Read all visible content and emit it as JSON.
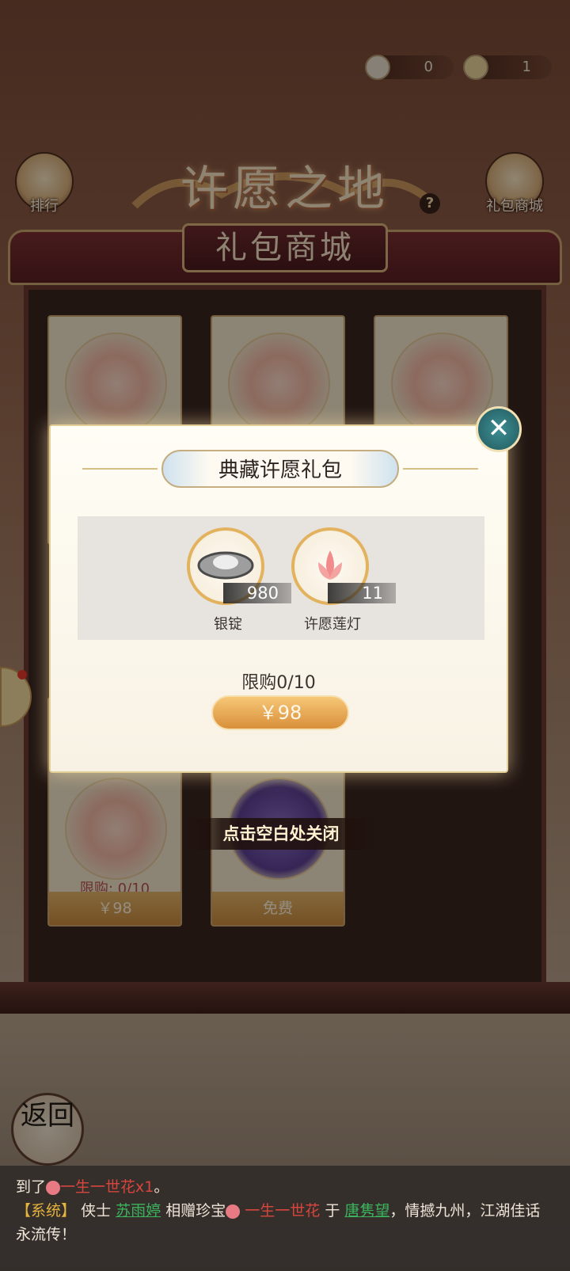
{
  "currency": [
    {
      "icon": "lotus-lantern-icon",
      "value": "0"
    },
    {
      "icon": "ginkgo-leaf-icon",
      "value": "1"
    }
  ],
  "header": {
    "title": "许愿之地",
    "help": "?"
  },
  "side": {
    "ranking_label": "排行",
    "shop_label": "礼包商城"
  },
  "shop": {
    "title": "礼包商城",
    "cards": [
      {
        "limit": "限购: 0/10",
        "price": "￥98"
      },
      {
        "limit": "",
        "price": "免费"
      }
    ]
  },
  "popup": {
    "title": "典藏许愿礼包",
    "items": [
      {
        "name": "银锭",
        "qty": "980",
        "icon": "silver-ingot-icon"
      },
      {
        "name": "许愿莲灯",
        "qty": "11",
        "icon": "lotus-lamp-icon"
      }
    ],
    "limit": "限购0/10",
    "price": "￥98",
    "close": "✕"
  },
  "hint": "点击空白处关闭",
  "back": "返回",
  "log": {
    "line1_prefix": "到了",
    "line1_item": "一生一世花x1",
    "line1_end": "。",
    "sys_tag": "【系统】",
    "part1": "侠士",
    "giver": "苏雨婷",
    "part2": "相赠珍宝",
    "gift": "一生一世花",
    "part3": "于",
    "receiver": "唐隽望",
    "part4": "，情撼九州，江湖佳话永流传！"
  }
}
